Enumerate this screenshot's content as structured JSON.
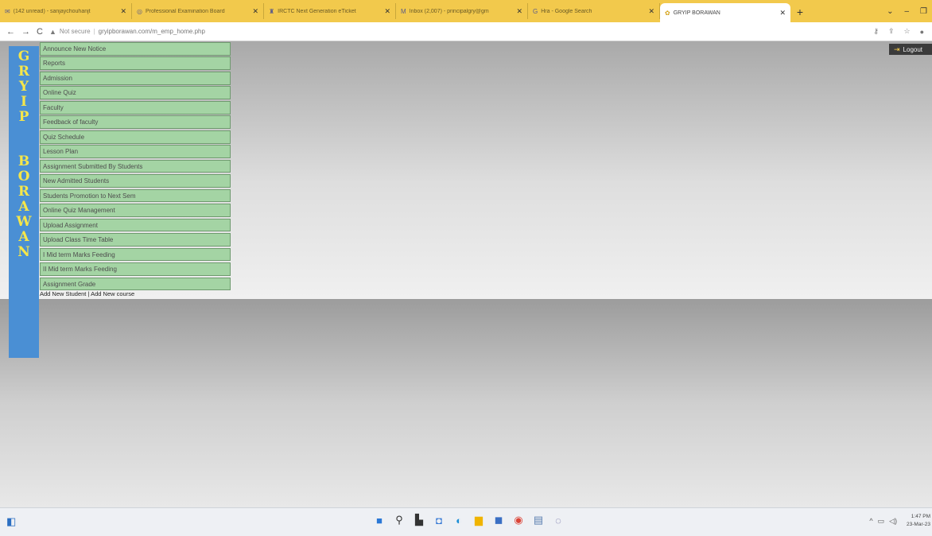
{
  "browser": {
    "tabs": [
      {
        "title": "(142 unread) - sanjaychouhanjt",
        "icon": "mail-icon"
      },
      {
        "title": "Professional Examination Board",
        "icon": "globe-icon"
      },
      {
        "title": "IRCTC Next Generation eTicket",
        "icon": "train-icon"
      },
      {
        "title": "Inbox (2,007) - principalgry@gm",
        "icon": "mail-icon"
      },
      {
        "title": "Hra - Google Search",
        "icon": "google-icon"
      },
      {
        "title": "GRYIP BORAWAN",
        "icon": "site-icon",
        "active": true
      }
    ],
    "new_tab": "+",
    "url": {
      "security": "Not secure",
      "address": "gryipborawan.com/m_emp_home.php"
    },
    "colors": {
      "tabstrip": "#f2c94c"
    }
  },
  "page": {
    "brand_letters_1": [
      "G",
      "R",
      "Y",
      "I",
      "P"
    ],
    "brand_letters_2": [
      "B",
      "O",
      "R",
      "A",
      "W",
      "A",
      "N"
    ],
    "menu": [
      "Announce New Notice",
      "Reports",
      "Admission",
      "Online Quiz",
      "Faculty",
      "Feedback of faculty",
      "Quiz Schedule",
      "Lesson Plan",
      "Assignment Submitted By Students",
      "New Admitted Students",
      "Students Promotion to Next Sem",
      "Online Quiz Management",
      "Upload Assignment",
      "Upload Class Time Table",
      "I Mid term Marks Feeding",
      "II Mid term Marks Feeding",
      "Assignment Grade"
    ],
    "links": {
      "add_student": "Add New Student",
      "separator": "|",
      "add_course": "Add New course"
    },
    "logout": "Logout",
    "colors": {
      "brand_bar": "#4a8fd4",
      "brand_text": "#f5e64a",
      "menu_bg": "#a4d4a4"
    }
  },
  "taskbar": {
    "clock_time": "1:47 PM",
    "clock_date": "23-Mar-23"
  }
}
